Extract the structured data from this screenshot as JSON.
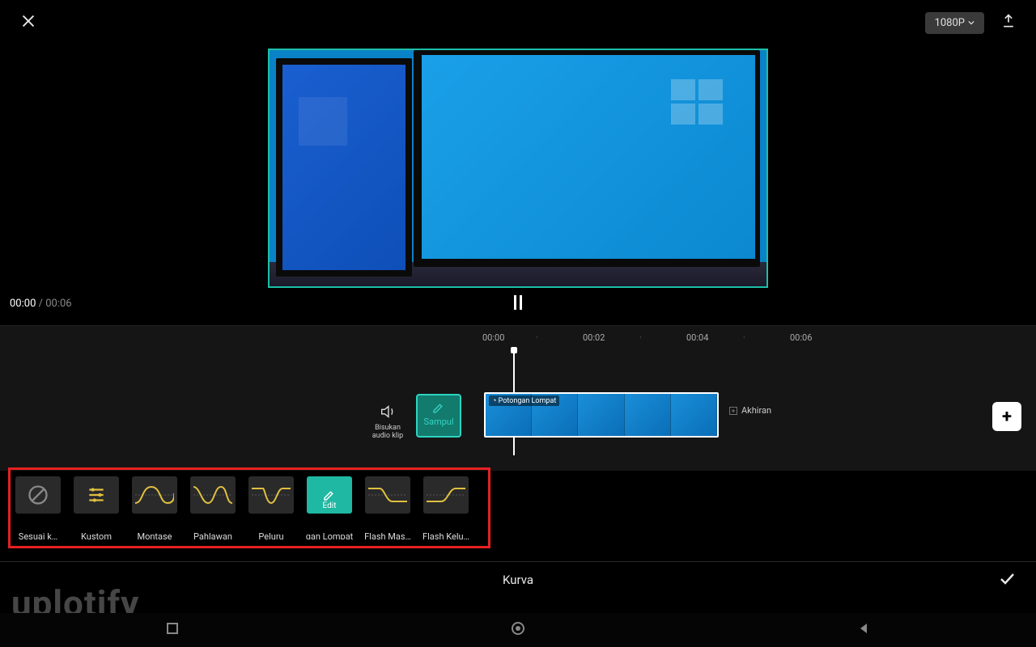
{
  "topbar": {
    "resolution_label": "1080P"
  },
  "playback": {
    "current": "00:00",
    "total": "00:06"
  },
  "ruler": {
    "marks": [
      "00:00",
      "00:02",
      "00:04",
      "00:06"
    ]
  },
  "sidebuttons": {
    "mute_label": "Bisukan audio klip",
    "sampul_label": "Sampul"
  },
  "clip": {
    "badge": "Potongan Lompat"
  },
  "akhiran_label": "Akhiran",
  "presets": [
    {
      "key": "none",
      "label": "Sesuai  k…"
    },
    {
      "key": "custom",
      "label": "Kustom"
    },
    {
      "key": "montase",
      "label": "Montase"
    },
    {
      "key": "pahlawan",
      "label": "Pahlawan"
    },
    {
      "key": "peluru",
      "label": "Peluru"
    },
    {
      "key": "lompat",
      "label": "gan Lompat",
      "active": true,
      "inside_label": "Edit"
    },
    {
      "key": "flashin",
      "label": "Flash Mas…"
    },
    {
      "key": "flashout",
      "label": "Flash Kelu…"
    }
  ],
  "bottombar": {
    "title": "Kurva"
  },
  "watermark": "uplotify"
}
